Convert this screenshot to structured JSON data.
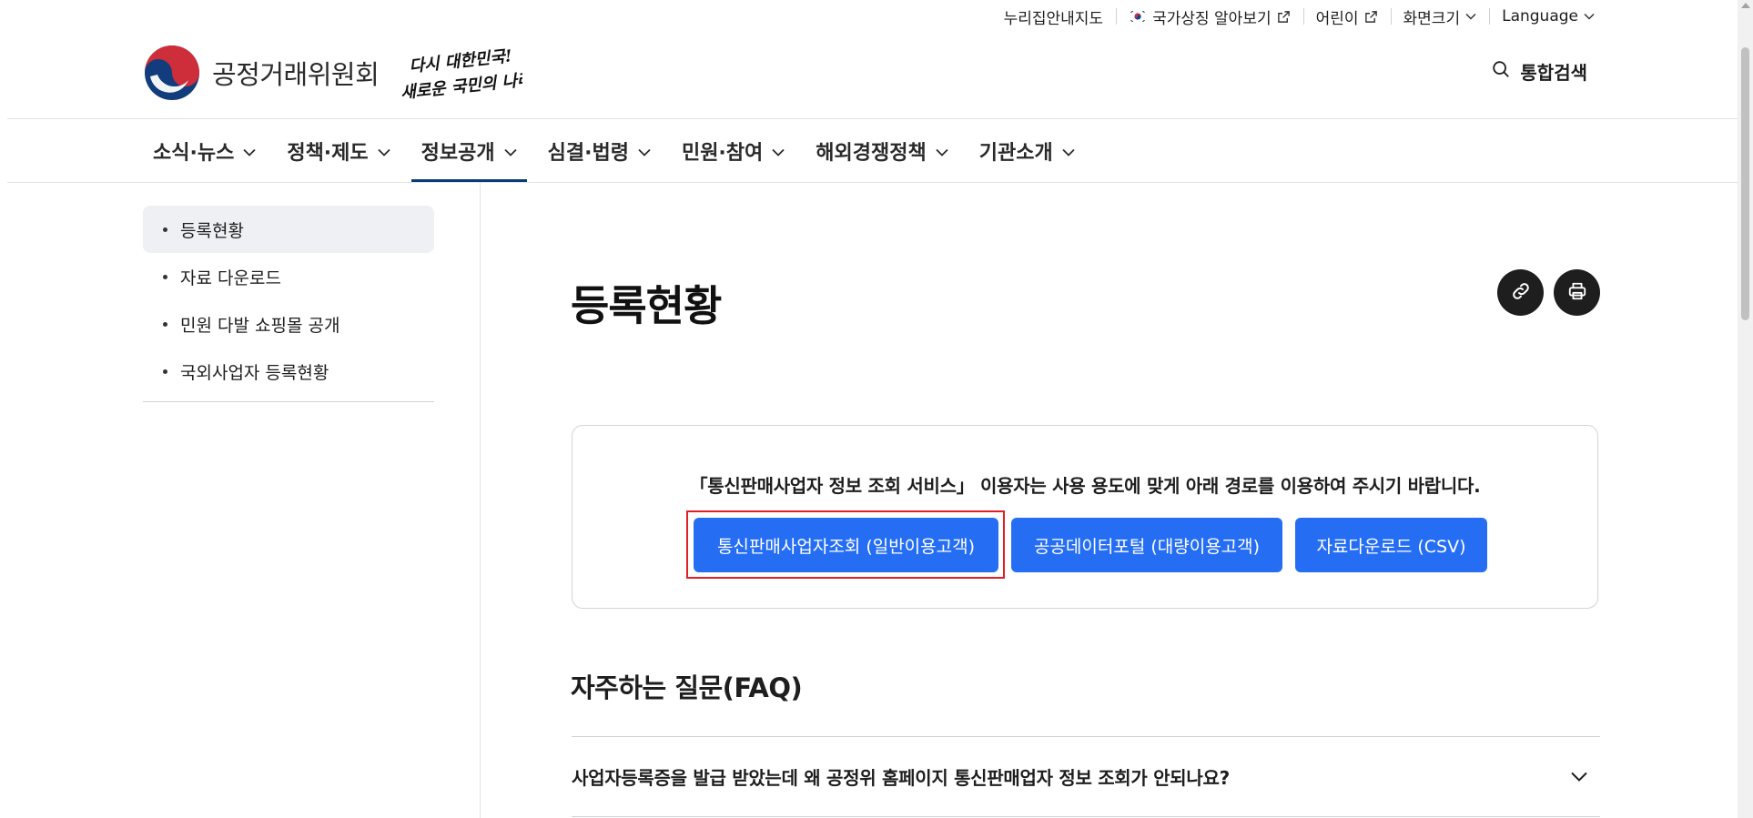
{
  "utility": {
    "sitemap": "누리집안내지도",
    "national_symbol": "국가상징 알아보기",
    "kids": "어린이",
    "font_size": "화면크기",
    "language": "Language"
  },
  "header": {
    "org_name": "공정거래위원회",
    "slogan_line1": "다시 대한민국!",
    "slogan_line2": "새로운 국민의 나라",
    "search_label": "통합검색"
  },
  "gnb": [
    {
      "label": "소식·뉴스"
    },
    {
      "label": "정책·제도"
    },
    {
      "label": "정보공개",
      "active": true
    },
    {
      "label": "심결·법령"
    },
    {
      "label": "민원·참여"
    },
    {
      "label": "해외경쟁정책"
    },
    {
      "label": "기관소개"
    }
  ],
  "sidebar": {
    "items": [
      {
        "label": "등록현황",
        "active": true
      },
      {
        "label": "자료 다운로드"
      },
      {
        "label": "민원 다발 쇼핑몰 공개"
      },
      {
        "label": "국외사업자 등록현황"
      }
    ]
  },
  "main": {
    "title": "등록현황",
    "notice": "「통신판매사업자 정보 조회 서비스」 이용자는 사용 용도에 맞게 아래 경로를 이용하여 주시기 바랍니다.",
    "buttons": [
      {
        "label": "통신판매사업자조회 (일반이용고객)"
      },
      {
        "label": "공공데이터포털 (대량이용고객)"
      },
      {
        "label": "자료다운로드 (CSV)"
      }
    ],
    "faq_title": "자주하는 질문(FAQ)",
    "faq_items": [
      {
        "question": "사업자등록증을 발급 받았는데 왜 공정위 홈페이지 통신판매업자 정보 조회가 안되나요?"
      }
    ]
  },
  "colors": {
    "primary_button": "#256ef4",
    "active_nav": "#0b3b75",
    "highlight": "#e01e28"
  }
}
